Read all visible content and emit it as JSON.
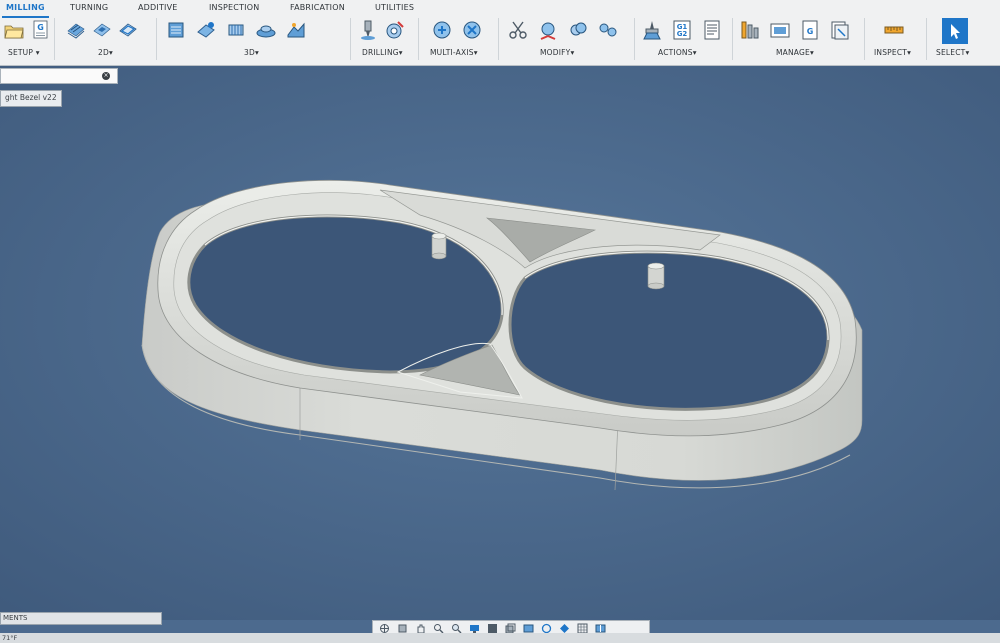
{
  "ribbon": {
    "tabs": [
      "MILLING",
      "TURNING",
      "ADDITIVE",
      "INSPECTION",
      "FABRICATION",
      "UTILITIES"
    ],
    "groups": {
      "setup": "SETUP",
      "twod": "2D",
      "threed": "3D",
      "drilling": "DRILLING",
      "multiaxis": "MULTI-AXIS",
      "modify": "MODIFY",
      "actions": "ACTIONS",
      "manage": "MANAGE",
      "inspect": "INSPECT",
      "select": "SELECT"
    },
    "glyphs": {
      "g": "G",
      "g1": "G1",
      "g2": "G2"
    },
    "dropdown_glyph": "▾"
  },
  "browser": {
    "document_label": "ght Bezel v22",
    "close_glyph": "×"
  },
  "bottom": {
    "comments_label": "MENTS",
    "temperature": "71°F"
  },
  "colors": {
    "accent": "#1f76c8",
    "viewport_bg": "#4c6a8e",
    "model": "#d5d7d4"
  },
  "icons": {
    "navbar": [
      "orbit-icon",
      "pan-icon",
      "hand-icon",
      "zoom-icon",
      "zoom-window-icon",
      "display-settings-icon",
      "visual-style-icon",
      "environment-icon",
      "effects-icon",
      "object-visibility-icon",
      "camera-icon",
      "grid-icon",
      "viewports-icon"
    ]
  }
}
